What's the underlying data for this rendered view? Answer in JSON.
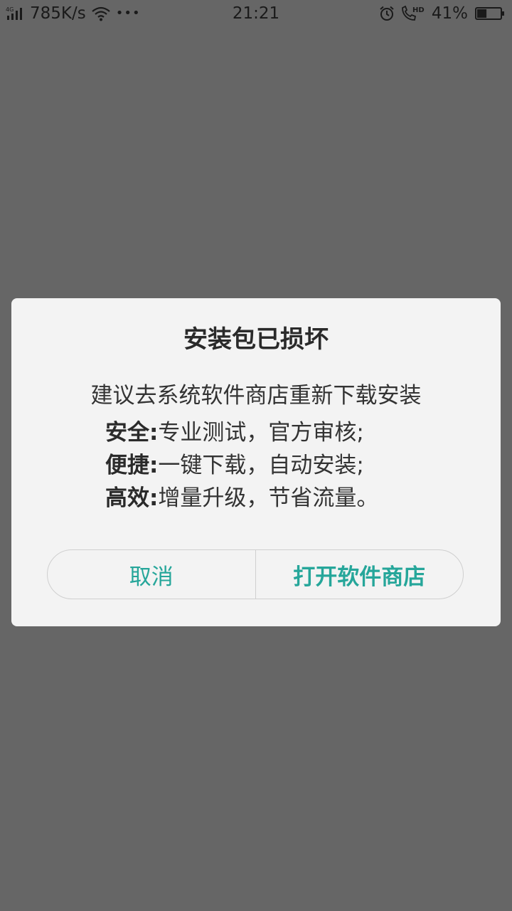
{
  "status_bar": {
    "network_type": "4G",
    "speed": "785K/s",
    "more": "•••",
    "time": "21:21",
    "hd_label": "HD",
    "battery_percent": "41%",
    "battery_level": 0.41
  },
  "dialog": {
    "title": "安装包已损坏",
    "subtitle": "建议去系统软件商店重新下载安装",
    "features": [
      {
        "key": "安全:",
        "text": "专业测试，官方审核;"
      },
      {
        "key": "便捷:",
        "text": "一键下载，自动安装;"
      },
      {
        "key": "高效:",
        "text": "增量升级，节省流量。"
      }
    ],
    "cancel_label": "取消",
    "open_store_label": "打开软件商店"
  },
  "colors": {
    "accent": "#26a69a",
    "overlay": "#666666",
    "dialog_bg": "#f3f3f3"
  }
}
